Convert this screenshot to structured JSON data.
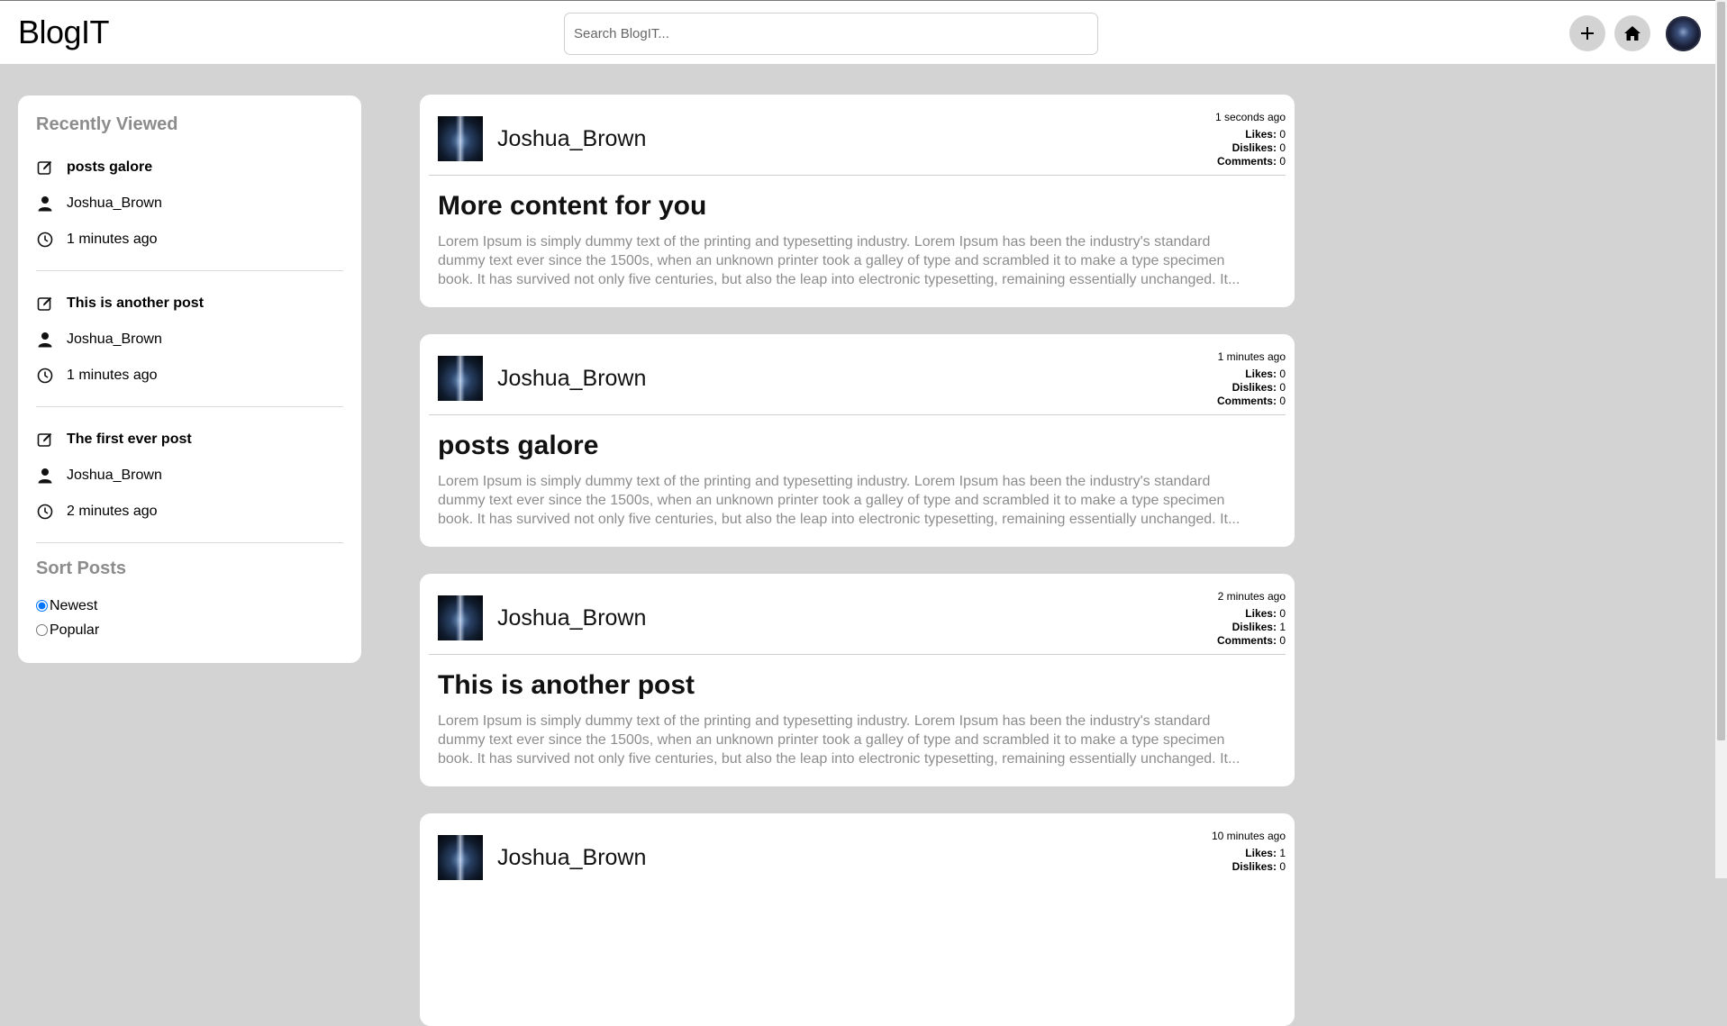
{
  "header": {
    "brand": "BlogIT",
    "search_placeholder": "Search BlogIT..."
  },
  "icons": {
    "add": "plus-icon",
    "home": "home-icon",
    "profile": "profile-avatar",
    "post": "edit-icon",
    "user": "user-icon",
    "time": "clock-icon"
  },
  "sidebar": {
    "recent_heading": "Recently Viewed",
    "recent": [
      {
        "title": "posts galore",
        "author": "Joshua_Brown",
        "time": "1 minutes ago"
      },
      {
        "title": "This is another post",
        "author": "Joshua_Brown",
        "time": "1 minutes ago"
      },
      {
        "title": "The first ever post",
        "author": "Joshua_Brown",
        "time": "2 minutes ago"
      }
    ],
    "sort_heading": "Sort Posts",
    "sort_options": [
      {
        "label": "Newest",
        "checked": true
      },
      {
        "label": "Popular",
        "checked": false
      }
    ]
  },
  "labels": {
    "likes": "Likes:",
    "dislikes": "Dislikes:",
    "comments": "Comments:"
  },
  "posts": [
    {
      "author": "Joshua_Brown",
      "time": "1 seconds ago",
      "likes": "0",
      "dislikes": "0",
      "comments": "0",
      "title": "More content for you",
      "excerpt": "Lorem Ipsum is simply dummy text of the printing and typesetting industry. Lorem Ipsum has been the industry's standard dummy text ever since the 1500s, when an unknown printer took a galley of type and scrambled it to make a type specimen book. It has survived not only five centuries, but also the leap into electronic typesetting, remaining essentially unchanged. It..."
    },
    {
      "author": "Joshua_Brown",
      "time": "1 minutes ago",
      "likes": "0",
      "dislikes": "0",
      "comments": "0",
      "title": "posts galore",
      "excerpt": "Lorem Ipsum is simply dummy text of the printing and typesetting industry. Lorem Ipsum has been the industry's standard dummy text ever since the 1500s, when an unknown printer took a galley of type and scrambled it to make a type specimen book. It has survived not only five centuries, but also the leap into electronic typesetting, remaining essentially unchanged. It..."
    },
    {
      "author": "Joshua_Brown",
      "time": "2 minutes ago",
      "likes": "0",
      "dislikes": "1",
      "comments": "0",
      "title": "This is another post",
      "excerpt": "Lorem Ipsum is simply dummy text of the printing and typesetting industry. Lorem Ipsum has been the industry's standard dummy text ever since the 1500s, when an unknown printer took a galley of type and scrambled it to make a type specimen book. It has survived not only five centuries, but also the leap into electronic typesetting, remaining essentially unchanged. It..."
    },
    {
      "author": "Joshua_Brown",
      "time": "10 minutes ago",
      "likes": "1",
      "dislikes": "0",
      "comments": "",
      "title": "",
      "excerpt": ""
    }
  ]
}
